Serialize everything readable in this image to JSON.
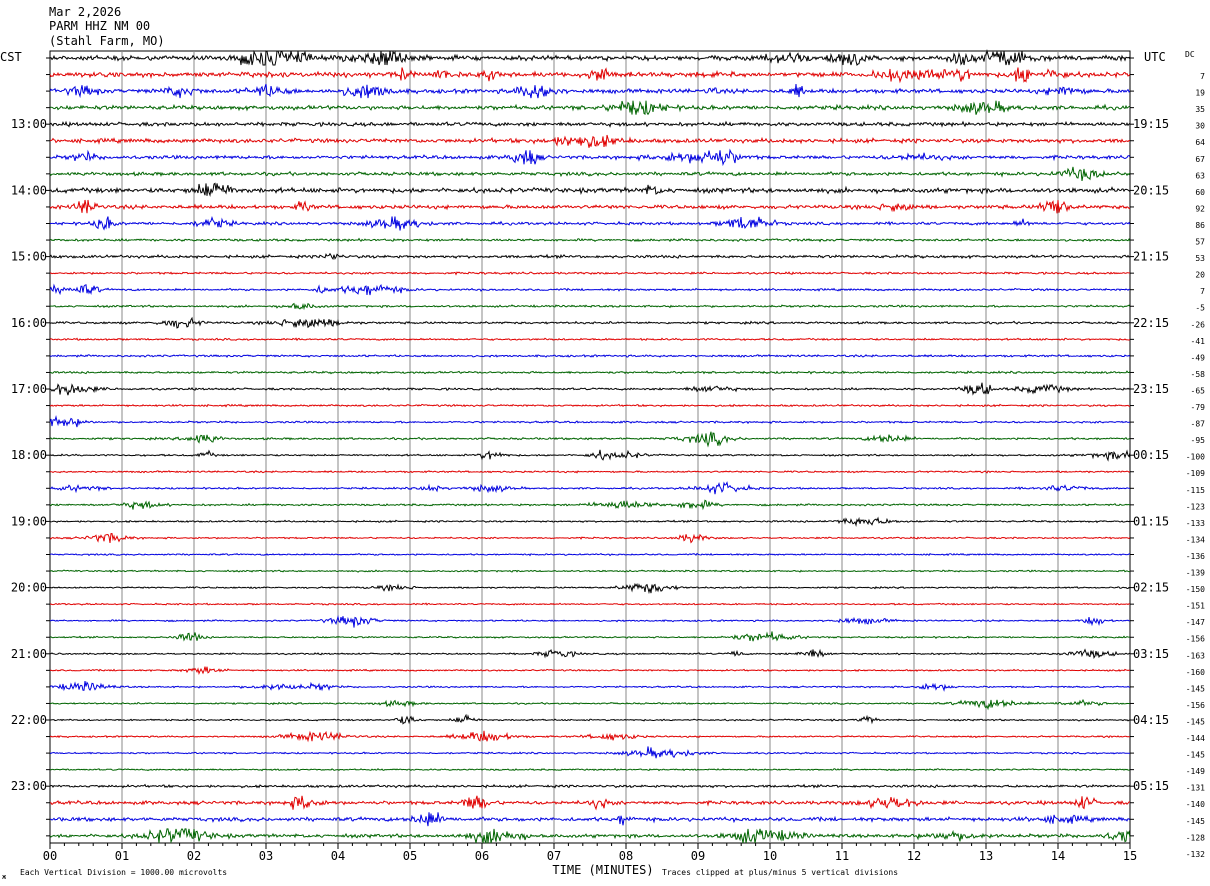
{
  "header": {
    "date": "Mar 2,2026",
    "station": "PARM HHZ NM 00",
    "location": "(Stahl Farm, MO)"
  },
  "labels": {
    "left_zone": "CST",
    "right_zone": "UTC",
    "dc_header": "DC",
    "xlabel": "TIME (MINUTES)",
    "footer_left": "Each Vertical Division = 1000.00 microvolts",
    "footer_right": "Traces clipped at plus/minus 5 vertical divisions",
    "corner_mark": "ж"
  },
  "chart_data": {
    "type": "helicorder",
    "x_ticks": [
      "00",
      "01",
      "02",
      "03",
      "04",
      "05",
      "06",
      "07",
      "08",
      "09",
      "10",
      "11",
      "12",
      "13",
      "14",
      "15"
    ],
    "xlim": [
      0,
      15
    ],
    "colors": [
      "#000000",
      "#e00000",
      "#0000e0",
      "#006400"
    ],
    "left_hours": [
      "13:00",
      "14:00",
      "15:00",
      "16:00",
      "17:00",
      "18:00",
      "19:00",
      "20:00",
      "21:00",
      "22:00",
      "23:00"
    ],
    "right_hours": [
      "19:15",
      "20:15",
      "21:15",
      "22:15",
      "23:15",
      "00:15",
      "01:15",
      "02:15",
      "03:15",
      "04:15",
      "05:15"
    ],
    "dc_values": [
      "7",
      "19",
      "35",
      "30",
      "64",
      "67",
      "63",
      "60",
      "92",
      "86",
      "57",
      "53",
      "20",
      "7",
      "-5",
      "-26",
      "-41",
      "-49",
      "-58",
      "-65",
      "-79",
      "-87",
      "-95",
      "-100",
      "-109",
      "-115",
      "-123",
      "-133",
      "-134",
      "-136",
      "-139",
      "-150",
      "-151",
      "-147",
      "-156",
      "-163",
      "-160",
      "-145",
      "-156",
      "-145",
      "-144",
      "-145",
      "-149",
      "-131",
      "-140",
      "-145",
      "-128",
      "-132"
    ],
    "trace_activity": [
      3,
      3,
      2.6,
      2.6,
      2.4,
      2.6,
      2.2,
      2.2,
      3,
      2.4,
      1.8,
      1.5,
      1.8,
      1.3,
      1.3,
      1.3,
      1.4,
      1.2,
      1.3,
      1.3,
      1.3,
      1.2,
      1.2,
      1.3,
      1.1,
      1.1,
      1.1,
      1.2,
      1.1,
      1,
      1,
      1,
      1,
      1,
      1,
      1,
      1,
      1,
      1,
      1,
      1,
      1,
      1,
      1,
      1.6,
      2.2,
      2.4,
      2.2
    ],
    "grid": true
  }
}
